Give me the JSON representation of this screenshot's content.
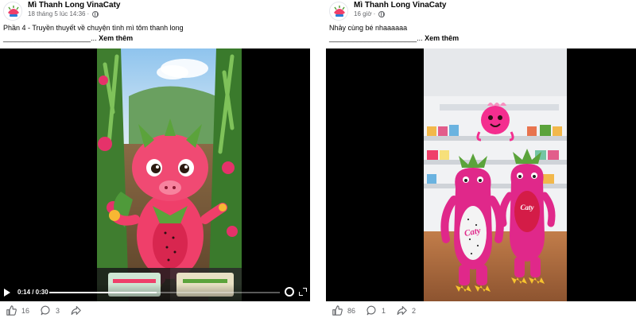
{
  "posts": [
    {
      "page_name": "Mì Thanh Long VinaCaty",
      "timestamp": "18 tháng 5 lúc 14:36",
      "caption_line1": "Phần 4 - Truyền thuyết về chuyện tình mì tôm thanh long",
      "caption_line2": "______________________...",
      "see_more": "Xem thêm",
      "video": {
        "time": "0:14 / 0:30",
        "progress": 0.467
      },
      "likes": "16",
      "comments": "3"
    },
    {
      "page_name": "Mì Thanh Long VinaCaty",
      "timestamp": "16 giờ",
      "caption_line1": "Nhảy cùng bé nhaaaaaa",
      "caption_line2": "______________________...",
      "see_more": "Xem thêm",
      "mascot_text": "Caty",
      "likes": "86",
      "comments": "1",
      "shares": "2"
    }
  ],
  "colors": {
    "dragon_pink": "#ef3f6a",
    "mascot_magenta": "#e0288a",
    "leaf_green": "#5ba33b",
    "sky": "#a9d1f0"
  },
  "icons": [
    "globe-icon",
    "play-icon",
    "settings-icon",
    "fullscreen-icon",
    "like-icon",
    "comment-icon",
    "share-icon"
  ]
}
